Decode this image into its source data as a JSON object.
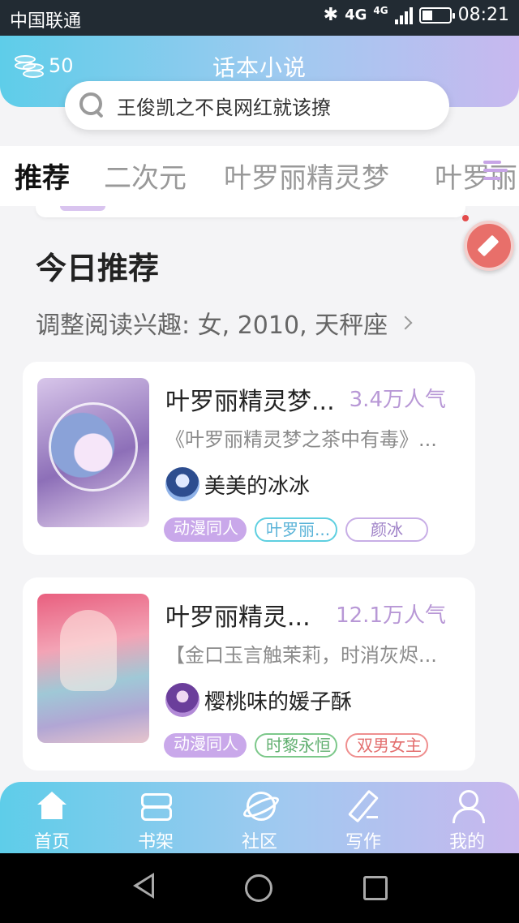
{
  "status_bar": {
    "carrier": "中国联通",
    "signal": "4G",
    "signal2": "4G",
    "time": "08:21"
  },
  "header": {
    "coins": "50",
    "title": "话本小说"
  },
  "search": {
    "query": "王俊凯之不良网红就该撩"
  },
  "tabs": [
    {
      "label": "推荐",
      "active": true
    },
    {
      "label": "二次元"
    },
    {
      "label": "叶罗丽精灵梦"
    },
    {
      "label": "叶罗丽"
    }
  ],
  "section": {
    "title": "今日推荐",
    "interest": "调整阅读兴趣: 女, 2010, 天秤座"
  },
  "books": [
    {
      "title": "叶罗丽精灵梦...",
      "heat": "3.4万人气",
      "desc": "《叶罗丽精灵梦之茶中有毒》...",
      "author": "美美的冰冰",
      "tags": [
        "动漫同人",
        "叶罗丽...",
        "颜冰"
      ]
    },
    {
      "title": "叶罗丽精灵...",
      "heat": "12.1万人气",
      "desc": "【金口玉言触茉莉，时消灰烬...",
      "author": "樱桃味的媛子酥",
      "tags": [
        "动漫同人",
        "时黎永恒",
        "双男女主"
      ]
    }
  ],
  "bottom_nav": [
    {
      "label": "首页",
      "icon": "home-icon"
    },
    {
      "label": "书架",
      "icon": "bookshelf-icon"
    },
    {
      "label": "社区",
      "icon": "planet-icon"
    },
    {
      "label": "写作",
      "icon": "pen-icon"
    },
    {
      "label": "我的",
      "icon": "user-icon"
    }
  ],
  "colors": {
    "accent_cyan": "#5ecde9",
    "accent_purple": "#c8b8ef",
    "heat_color": "#b898d6"
  }
}
